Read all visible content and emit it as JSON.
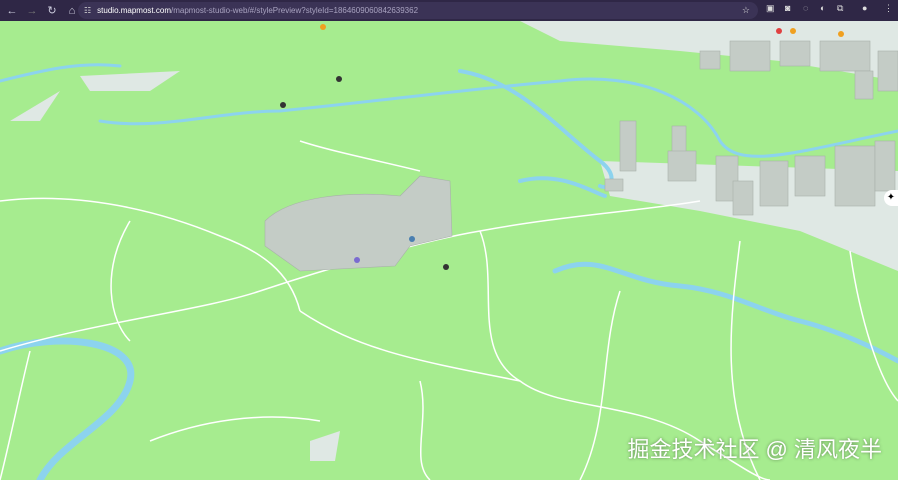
{
  "browser": {
    "url_host": "studio.mapmost.com",
    "url_path": "/mapmost-studio-web/#/stylePreview?styleId=1864609060842639362"
  },
  "colors": {
    "land": "#a6ec8f",
    "water": "#8cd3ee",
    "road": "#ffffff",
    "building": "#c4ccc6",
    "urban": "#dfe8e4"
  },
  "watermark": "掘金技术社区 @ 清风夜半"
}
